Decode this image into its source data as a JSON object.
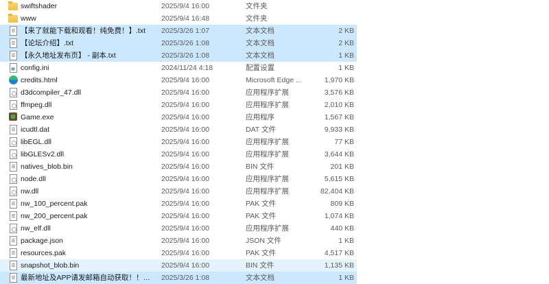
{
  "files": [
    {
      "name": "swiftshader",
      "date": "2025/9/4 16:00",
      "type": "文件夹",
      "size": "",
      "icon": "folder-icon",
      "state": "normal"
    },
    {
      "name": "www",
      "date": "2025/9/4 16:48",
      "type": "文件夹",
      "size": "",
      "icon": "folder-icon",
      "state": "normal"
    },
    {
      "name": "【来了就能下载和观看！纯免费！】.txt",
      "date": "2025/3/26 1:07",
      "type": "文本文档",
      "size": "2 KB",
      "icon": "text-file-icon",
      "state": "selected"
    },
    {
      "name": "【论坛介绍】.txt",
      "date": "2025/3/26 1:08",
      "type": "文本文档",
      "size": "2 KB",
      "icon": "text-file-icon",
      "state": "selected"
    },
    {
      "name": "【永久地址发布页】 - 副本.txt",
      "date": "2025/3/26 1:08",
      "type": "文本文档",
      "size": "1 KB",
      "icon": "text-file-icon",
      "state": "selected"
    },
    {
      "name": "config.ini",
      "date": "2024/11/24 4:18",
      "type": "配置设置",
      "size": "1 KB",
      "icon": "config-file-icon",
      "state": "normal"
    },
    {
      "name": "credits.html",
      "date": "2025/9/4 16:00",
      "type": "Microsoft Edge ...",
      "size": "1,970 KB",
      "icon": "edge-icon",
      "state": "normal"
    },
    {
      "name": "d3dcompiler_47.dll",
      "date": "2025/9/4 16:00",
      "type": "应用程序扩展",
      "size": "3,576 KB",
      "icon": "dll-file-icon",
      "state": "normal"
    },
    {
      "name": "ffmpeg.dll",
      "date": "2025/9/4 16:00",
      "type": "应用程序扩展",
      "size": "2,010 KB",
      "icon": "dll-file-icon",
      "state": "normal"
    },
    {
      "name": "Game.exe",
      "date": "2025/9/4 16:00",
      "type": "应用程序",
      "size": "1,567 KB",
      "icon": "game-exe-icon",
      "state": "normal"
    },
    {
      "name": "icudtl.dat",
      "date": "2025/9/4 16:00",
      "type": "DAT 文件",
      "size": "9,933 KB",
      "icon": "blank-file-icon",
      "state": "normal"
    },
    {
      "name": "libEGL.dll",
      "date": "2025/9/4 16:00",
      "type": "应用程序扩展",
      "size": "77 KB",
      "icon": "dll-file-icon",
      "state": "normal"
    },
    {
      "name": "libGLESv2.dll",
      "date": "2025/9/4 16:00",
      "type": "应用程序扩展",
      "size": "3,644 KB",
      "icon": "dll-file-icon",
      "state": "normal"
    },
    {
      "name": "natives_blob.bin",
      "date": "2025/9/4 16:00",
      "type": "BIN 文件",
      "size": "201 KB",
      "icon": "blank-file-icon",
      "state": "normal"
    },
    {
      "name": "node.dll",
      "date": "2025/9/4 16:00",
      "type": "应用程序扩展",
      "size": "5,615 KB",
      "icon": "dll-file-icon",
      "state": "normal"
    },
    {
      "name": "nw.dll",
      "date": "2025/9/4 16:00",
      "type": "应用程序扩展",
      "size": "82,404 KB",
      "icon": "dll-file-icon",
      "state": "normal"
    },
    {
      "name": "nw_100_percent.pak",
      "date": "2025/9/4 16:00",
      "type": "PAK 文件",
      "size": "809 KB",
      "icon": "blank-file-icon",
      "state": "normal"
    },
    {
      "name": "nw_200_percent.pak",
      "date": "2025/9/4 16:00",
      "type": "PAK 文件",
      "size": "1,074 KB",
      "icon": "blank-file-icon",
      "state": "normal"
    },
    {
      "name": "nw_elf.dll",
      "date": "2025/9/4 16:00",
      "type": "应用程序扩展",
      "size": "440 KB",
      "icon": "dll-file-icon",
      "state": "normal"
    },
    {
      "name": "package.json",
      "date": "2025/9/4 16:00",
      "type": "JSON 文件",
      "size": "1 KB",
      "icon": "blank-file-icon",
      "state": "normal"
    },
    {
      "name": "resources.pak",
      "date": "2025/9/4 16:00",
      "type": "PAK 文件",
      "size": "4,517 KB",
      "icon": "blank-file-icon",
      "state": "normal"
    },
    {
      "name": "snapshot_blob.bin",
      "date": "2025/9/4 16:00",
      "type": "BIN 文件",
      "size": "1,135 KB",
      "icon": "blank-file-icon",
      "state": "hover"
    },
    {
      "name": "最新地址及APP请发邮箱自动获取！！！....",
      "date": "2025/3/26 1:08",
      "type": "文本文档",
      "size": "1 KB",
      "icon": "text-file-icon",
      "state": "selected"
    }
  ]
}
